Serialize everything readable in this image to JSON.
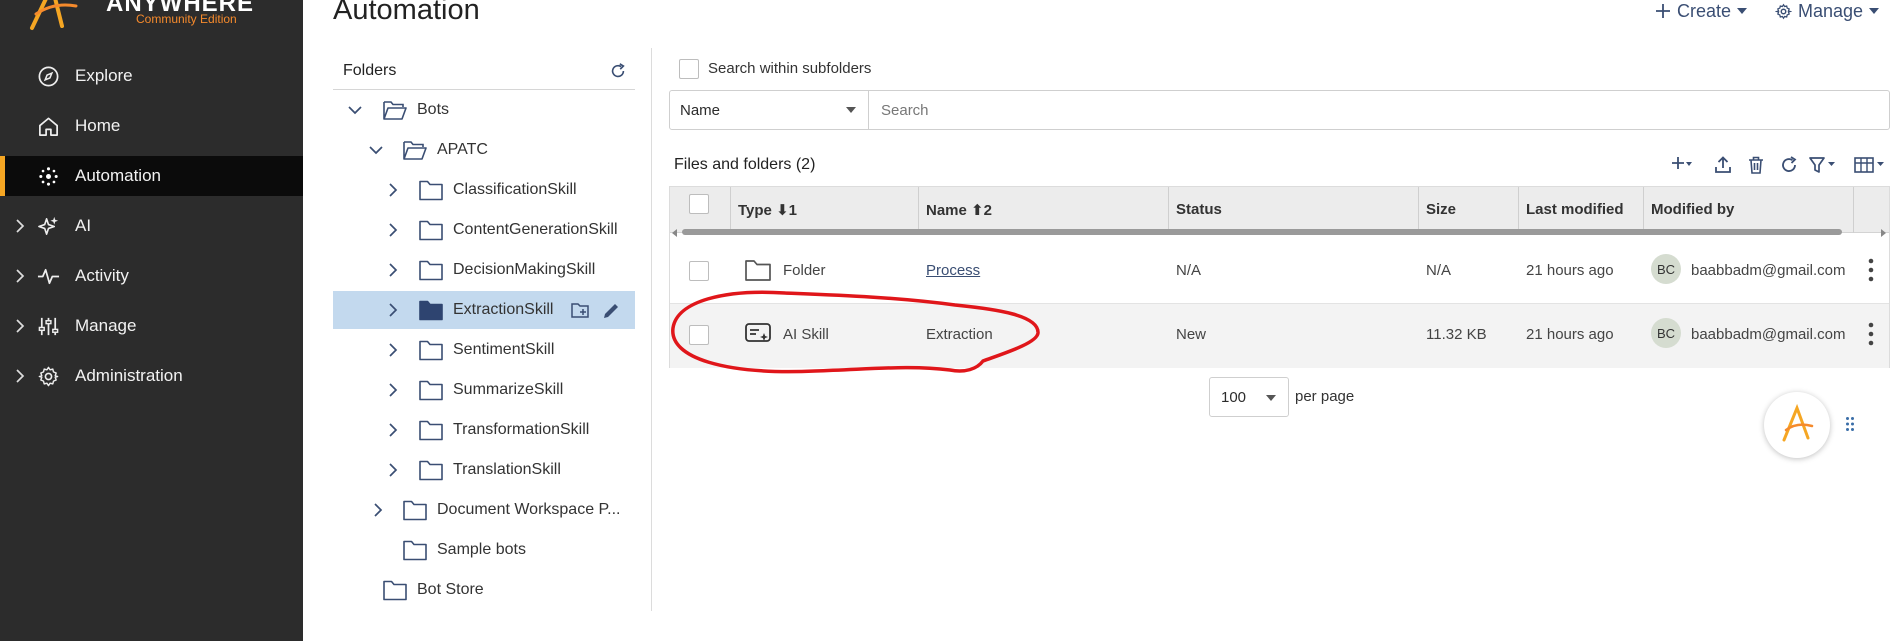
{
  "brand": {
    "name": "ANYWHERE",
    "edition": "Community Edition",
    "accent": "#f5a623",
    "orange": "#f58a2c"
  },
  "sidebar": {
    "items": [
      {
        "label": "Explore",
        "icon": "compass-icon",
        "expandable": false,
        "active": false
      },
      {
        "label": "Home",
        "icon": "home-icon",
        "expandable": false,
        "active": false
      },
      {
        "label": "Automation",
        "icon": "automation-dots-icon",
        "expandable": false,
        "active": true
      },
      {
        "label": "AI",
        "icon": "ai-sparkle-icon",
        "expandable": true,
        "active": false
      },
      {
        "label": "Activity",
        "icon": "activity-pulse-icon",
        "expandable": true,
        "active": false
      },
      {
        "label": "Manage",
        "icon": "sliders-icon",
        "expandable": true,
        "active": false
      },
      {
        "label": "Administration",
        "icon": "gear-icon",
        "expandable": true,
        "active": false
      }
    ]
  },
  "header": {
    "title": "Automation",
    "create_label": "Create",
    "manage_label": "Manage"
  },
  "folders": {
    "title": "Folders",
    "tree": [
      {
        "label": "Bots",
        "expanded": true
      },
      {
        "label": "APATC",
        "expanded": true
      },
      {
        "label": "ClassificationSkill"
      },
      {
        "label": "ContentGenerationSkill"
      },
      {
        "label": "DecisionMakingSkill"
      },
      {
        "label": "ExtractionSkill",
        "selected": true
      },
      {
        "label": "SentimentSkill"
      },
      {
        "label": "SummarizeSkill"
      },
      {
        "label": "TransformationSkill"
      },
      {
        "label": "TranslationSkill"
      },
      {
        "label": "Document Workspace P..."
      },
      {
        "label": "Sample bots"
      },
      {
        "label": "Bot Store"
      }
    ]
  },
  "filters": {
    "subfolders_label": "Search within subfolders",
    "field_selected": "Name",
    "search_placeholder": "Search"
  },
  "files": {
    "title": "Files and folders (2)",
    "columns": {
      "type": "Type",
      "type_sort": "⬇1",
      "name": "Name",
      "name_sort": "⬆2",
      "status": "Status",
      "size": "Size",
      "last_modified": "Last modified",
      "modified_by": "Modified by"
    },
    "rows": [
      {
        "type": "Folder",
        "icon": "folder-icon",
        "name": "Process",
        "status": "N/A",
        "size": "N/A",
        "last_modified": "21 hours ago",
        "avatar": "BC",
        "modified_by": "baabbadm@gmail.com"
      },
      {
        "type": "AI Skill",
        "icon": "ai-skill-icon",
        "name": "Extraction",
        "status": "New",
        "size": "11.32 KB",
        "last_modified": "21 hours ago",
        "avatar": "BC",
        "modified_by": "baabbadm@gmail.com"
      }
    ]
  },
  "pagination": {
    "page_size": "100",
    "per_page_label": "per page"
  }
}
